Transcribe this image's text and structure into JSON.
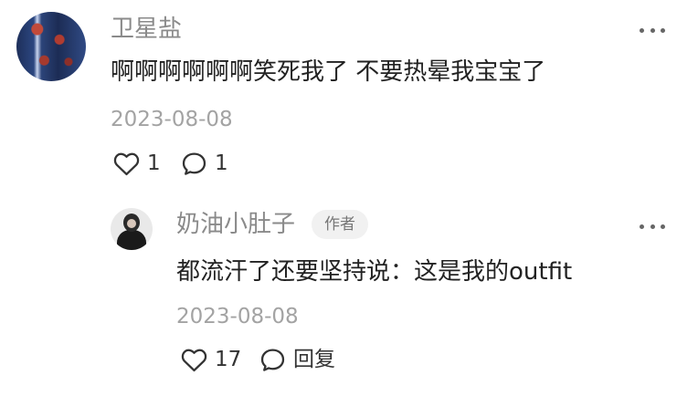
{
  "comments": [
    {
      "username": "卫星盐",
      "text": "啊啊啊啊啊啊笑死我了 不要热晕我宝宝了",
      "date": "2023-08-08",
      "likes": "1",
      "replies": "1"
    },
    {
      "username": "奶油小肚子",
      "badge": "作者",
      "text": "都流汗了还要坚持说：这是我的outfit",
      "date": "2023-08-08",
      "likes": "17",
      "reply_label": "回复"
    }
  ]
}
